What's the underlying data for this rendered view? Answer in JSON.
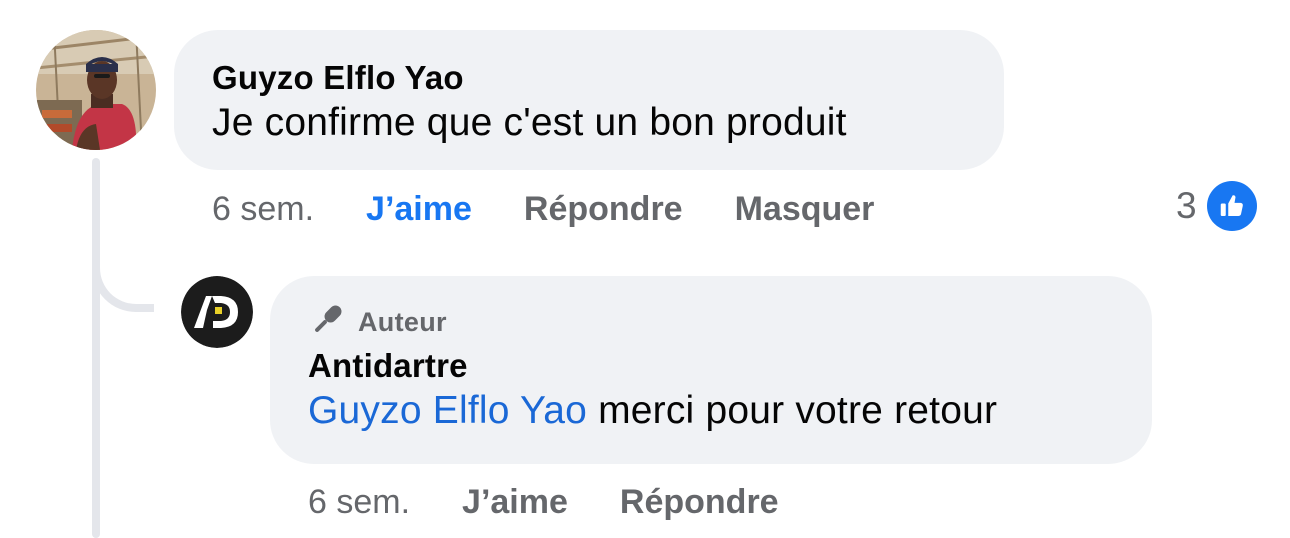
{
  "comment": {
    "author": "Guyzo Elflo Yao",
    "text": "Je confirme que c'est un bon produit",
    "time": "6 sem.",
    "actions": {
      "like": "J’aime",
      "reply": "Répondre",
      "hide": "Masquer"
    },
    "reaction_count": "3",
    "reaction_icon": "like-thumb-icon",
    "like_state": "liked"
  },
  "reply": {
    "badge": "Auteur",
    "badge_icon": "microphone-icon",
    "author": "Antidartre",
    "avatar_text": "AD",
    "mention": "Guyzo Elflo Yao",
    "text": " merci pour votre retour",
    "time": "6 sem.",
    "actions": {
      "like": "J’aime",
      "reply": "Répondre"
    }
  },
  "colors": {
    "bubble": "#f0f2f5",
    "text": "#050505",
    "secondary": "#65676b",
    "accent": "#1877f2",
    "mention": "#1a68d6"
  }
}
